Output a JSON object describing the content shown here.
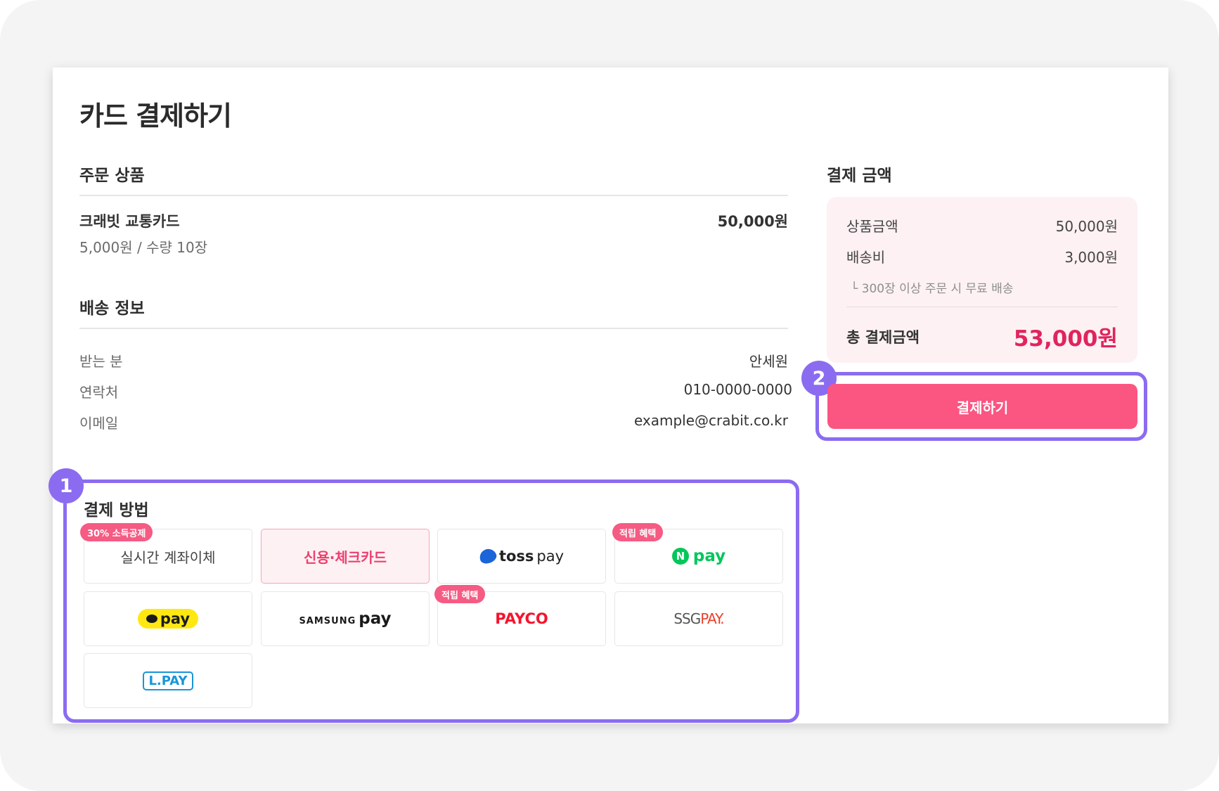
{
  "page_title": "카드 결제하기",
  "order": {
    "section_title": "주문 상품",
    "product_name": "크래빗 교통카드",
    "product_detail": "5,000원 / 수량 10장",
    "product_price": "50,000원"
  },
  "shipping": {
    "section_title": "배송 정보",
    "fields": [
      {
        "label": "받는 분",
        "value": "안세원"
      },
      {
        "label": "연락처",
        "value": "010-0000-0000"
      },
      {
        "label": "이메일",
        "value": "example@crabit.co.kr"
      }
    ]
  },
  "payment_methods": {
    "section_title": "결제 방법",
    "step_number": "1",
    "items": [
      {
        "label": "실시간 계좌이체",
        "badge": "30% 소득공제",
        "selected": false
      },
      {
        "label": "신용·체크카드",
        "selected": true
      },
      {
        "label": "tosspay",
        "logo_a": "toss",
        "logo_b": "pay"
      },
      {
        "label": "pay",
        "logo_n": "N",
        "badge": "적립 혜택"
      },
      {
        "label": "pay"
      },
      {
        "label": "pay",
        "logo_a": "SAMSUNG"
      },
      {
        "label": "PAYCO",
        "badge": "적립 혜택"
      },
      {
        "label": "SSGPAY.",
        "logo_a": "SSG",
        "logo_b": "PAY."
      },
      {
        "label": "L.PAY"
      }
    ]
  },
  "summary": {
    "section_title": "결제 금액",
    "rows": [
      {
        "label": "상품금액",
        "value": "50,000원"
      },
      {
        "label": "배송비",
        "value": "3,000원"
      }
    ],
    "note": "└ 300장 이상 주문 시 무료 배송",
    "total_label": "총 결제금액",
    "total_value": "53,000원"
  },
  "pay_button": {
    "label": "결제하기",
    "step_number": "2"
  },
  "colors": {
    "accent": "#fb5582",
    "total": "#e0245e",
    "highlight": "#8b6cf0",
    "summary_bg": "#fdf1f3"
  }
}
